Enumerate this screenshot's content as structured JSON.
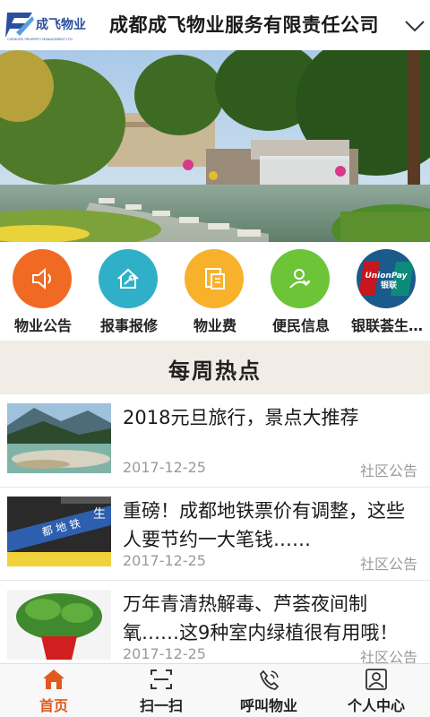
{
  "header": {
    "logo_text": "成飞物业",
    "logo_subtext": "CHENGFEI PROPERTY MANAGEMENT LTD",
    "company_name": "成都成飞物业服务有限责任公司"
  },
  "quick_menu": [
    {
      "label": "物业公告",
      "icon": "speaker-icon",
      "color": "#f06a24"
    },
    {
      "label": "报事报修",
      "icon": "house-wrench-icon",
      "color": "#2fb0c8"
    },
    {
      "label": "物业费",
      "icon": "bill-icon",
      "color": "#f7b12b"
    },
    {
      "label": "便民信息",
      "icon": "user-heart-icon",
      "color": "#6cc437"
    },
    {
      "label": "银联荟生…",
      "icon": "unionpay-icon",
      "color": "#1a5b8c"
    }
  ],
  "section": {
    "title": "每周热点"
  },
  "news": [
    {
      "title": "2018元旦旅行，景点大推荐",
      "date": "2017-12-25",
      "category": "社区公告"
    },
    {
      "title": "重磅！成都地铁票价有调整，这些人要节约一大笔钱……",
      "date": "2017-12-25",
      "category": "社区公告"
    },
    {
      "title": "万年青清热解毒、芦荟夜间制氧……这9种室内绿植很有用哦！",
      "date": "2017-12-25",
      "category": "社区公告"
    }
  ],
  "tabbar": [
    {
      "label": "首页",
      "icon": "home-icon",
      "active": true
    },
    {
      "label": "扫一扫",
      "icon": "scan-icon",
      "active": false
    },
    {
      "label": "呼叫物业",
      "icon": "phone-icon",
      "active": false
    },
    {
      "label": "个人中心",
      "icon": "profile-icon",
      "active": false
    }
  ],
  "colors": {
    "accent": "#e05a1f",
    "band": "#f1ece6"
  }
}
